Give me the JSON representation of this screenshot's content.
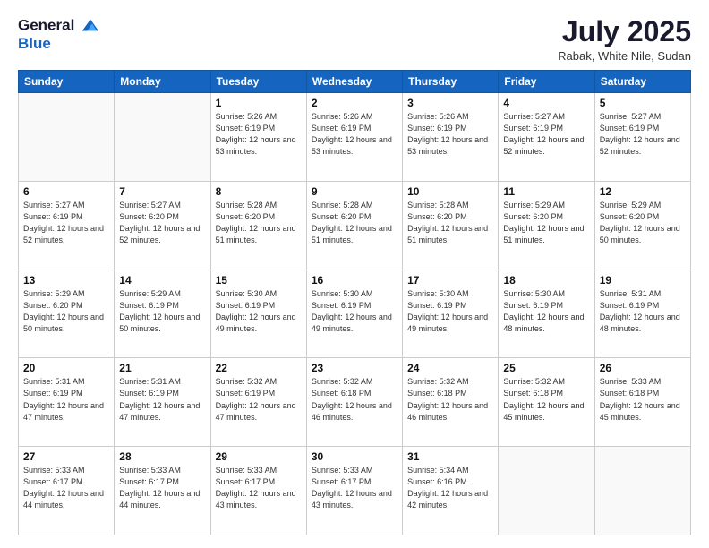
{
  "logo": {
    "general": "General",
    "blue": "Blue"
  },
  "header": {
    "month_year": "July 2025",
    "location": "Rabak, White Nile, Sudan"
  },
  "weekdays": [
    "Sunday",
    "Monday",
    "Tuesday",
    "Wednesday",
    "Thursday",
    "Friday",
    "Saturday"
  ],
  "weeks": [
    [
      {
        "day": "",
        "sunrise": "",
        "sunset": "",
        "daylight": ""
      },
      {
        "day": "",
        "sunrise": "",
        "sunset": "",
        "daylight": ""
      },
      {
        "day": "1",
        "sunrise": "Sunrise: 5:26 AM",
        "sunset": "Sunset: 6:19 PM",
        "daylight": "Daylight: 12 hours and 53 minutes."
      },
      {
        "day": "2",
        "sunrise": "Sunrise: 5:26 AM",
        "sunset": "Sunset: 6:19 PM",
        "daylight": "Daylight: 12 hours and 53 minutes."
      },
      {
        "day": "3",
        "sunrise": "Sunrise: 5:26 AM",
        "sunset": "Sunset: 6:19 PM",
        "daylight": "Daylight: 12 hours and 53 minutes."
      },
      {
        "day": "4",
        "sunrise": "Sunrise: 5:27 AM",
        "sunset": "Sunset: 6:19 PM",
        "daylight": "Daylight: 12 hours and 52 minutes."
      },
      {
        "day": "5",
        "sunrise": "Sunrise: 5:27 AM",
        "sunset": "Sunset: 6:19 PM",
        "daylight": "Daylight: 12 hours and 52 minutes."
      }
    ],
    [
      {
        "day": "6",
        "sunrise": "Sunrise: 5:27 AM",
        "sunset": "Sunset: 6:19 PM",
        "daylight": "Daylight: 12 hours and 52 minutes."
      },
      {
        "day": "7",
        "sunrise": "Sunrise: 5:27 AM",
        "sunset": "Sunset: 6:20 PM",
        "daylight": "Daylight: 12 hours and 52 minutes."
      },
      {
        "day": "8",
        "sunrise": "Sunrise: 5:28 AM",
        "sunset": "Sunset: 6:20 PM",
        "daylight": "Daylight: 12 hours and 51 minutes."
      },
      {
        "day": "9",
        "sunrise": "Sunrise: 5:28 AM",
        "sunset": "Sunset: 6:20 PM",
        "daylight": "Daylight: 12 hours and 51 minutes."
      },
      {
        "day": "10",
        "sunrise": "Sunrise: 5:28 AM",
        "sunset": "Sunset: 6:20 PM",
        "daylight": "Daylight: 12 hours and 51 minutes."
      },
      {
        "day": "11",
        "sunrise": "Sunrise: 5:29 AM",
        "sunset": "Sunset: 6:20 PM",
        "daylight": "Daylight: 12 hours and 51 minutes."
      },
      {
        "day": "12",
        "sunrise": "Sunrise: 5:29 AM",
        "sunset": "Sunset: 6:20 PM",
        "daylight": "Daylight: 12 hours and 50 minutes."
      }
    ],
    [
      {
        "day": "13",
        "sunrise": "Sunrise: 5:29 AM",
        "sunset": "Sunset: 6:20 PM",
        "daylight": "Daylight: 12 hours and 50 minutes."
      },
      {
        "day": "14",
        "sunrise": "Sunrise: 5:29 AM",
        "sunset": "Sunset: 6:19 PM",
        "daylight": "Daylight: 12 hours and 50 minutes."
      },
      {
        "day": "15",
        "sunrise": "Sunrise: 5:30 AM",
        "sunset": "Sunset: 6:19 PM",
        "daylight": "Daylight: 12 hours and 49 minutes."
      },
      {
        "day": "16",
        "sunrise": "Sunrise: 5:30 AM",
        "sunset": "Sunset: 6:19 PM",
        "daylight": "Daylight: 12 hours and 49 minutes."
      },
      {
        "day": "17",
        "sunrise": "Sunrise: 5:30 AM",
        "sunset": "Sunset: 6:19 PM",
        "daylight": "Daylight: 12 hours and 49 minutes."
      },
      {
        "day": "18",
        "sunrise": "Sunrise: 5:30 AM",
        "sunset": "Sunset: 6:19 PM",
        "daylight": "Daylight: 12 hours and 48 minutes."
      },
      {
        "day": "19",
        "sunrise": "Sunrise: 5:31 AM",
        "sunset": "Sunset: 6:19 PM",
        "daylight": "Daylight: 12 hours and 48 minutes."
      }
    ],
    [
      {
        "day": "20",
        "sunrise": "Sunrise: 5:31 AM",
        "sunset": "Sunset: 6:19 PM",
        "daylight": "Daylight: 12 hours and 47 minutes."
      },
      {
        "day": "21",
        "sunrise": "Sunrise: 5:31 AM",
        "sunset": "Sunset: 6:19 PM",
        "daylight": "Daylight: 12 hours and 47 minutes."
      },
      {
        "day": "22",
        "sunrise": "Sunrise: 5:32 AM",
        "sunset": "Sunset: 6:19 PM",
        "daylight": "Daylight: 12 hours and 47 minutes."
      },
      {
        "day": "23",
        "sunrise": "Sunrise: 5:32 AM",
        "sunset": "Sunset: 6:18 PM",
        "daylight": "Daylight: 12 hours and 46 minutes."
      },
      {
        "day": "24",
        "sunrise": "Sunrise: 5:32 AM",
        "sunset": "Sunset: 6:18 PM",
        "daylight": "Daylight: 12 hours and 46 minutes."
      },
      {
        "day": "25",
        "sunrise": "Sunrise: 5:32 AM",
        "sunset": "Sunset: 6:18 PM",
        "daylight": "Daylight: 12 hours and 45 minutes."
      },
      {
        "day": "26",
        "sunrise": "Sunrise: 5:33 AM",
        "sunset": "Sunset: 6:18 PM",
        "daylight": "Daylight: 12 hours and 45 minutes."
      }
    ],
    [
      {
        "day": "27",
        "sunrise": "Sunrise: 5:33 AM",
        "sunset": "Sunset: 6:17 PM",
        "daylight": "Daylight: 12 hours and 44 minutes."
      },
      {
        "day": "28",
        "sunrise": "Sunrise: 5:33 AM",
        "sunset": "Sunset: 6:17 PM",
        "daylight": "Daylight: 12 hours and 44 minutes."
      },
      {
        "day": "29",
        "sunrise": "Sunrise: 5:33 AM",
        "sunset": "Sunset: 6:17 PM",
        "daylight": "Daylight: 12 hours and 43 minutes."
      },
      {
        "day": "30",
        "sunrise": "Sunrise: 5:33 AM",
        "sunset": "Sunset: 6:17 PM",
        "daylight": "Daylight: 12 hours and 43 minutes."
      },
      {
        "day": "31",
        "sunrise": "Sunrise: 5:34 AM",
        "sunset": "Sunset: 6:16 PM",
        "daylight": "Daylight: 12 hours and 42 minutes."
      },
      {
        "day": "",
        "sunrise": "",
        "sunset": "",
        "daylight": ""
      },
      {
        "day": "",
        "sunrise": "",
        "sunset": "",
        "daylight": ""
      }
    ]
  ]
}
